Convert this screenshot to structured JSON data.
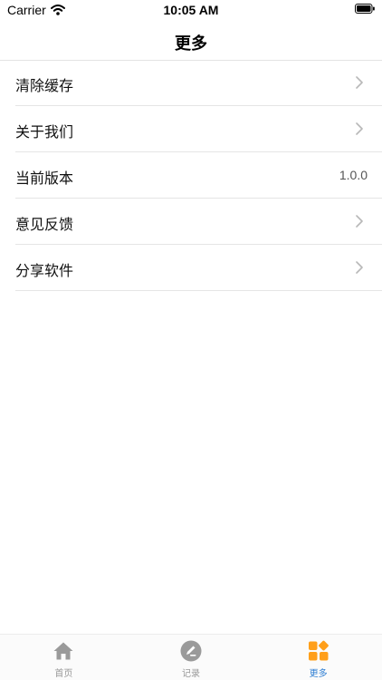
{
  "status_bar": {
    "carrier": "Carrier",
    "time": "10:05 AM"
  },
  "nav": {
    "title": "更多"
  },
  "menu": {
    "items": [
      {
        "label": "清除缓存",
        "value": ""
      },
      {
        "label": "关于我们",
        "value": ""
      },
      {
        "label": "当前版本",
        "value": "1.0.0"
      },
      {
        "label": "意见反馈",
        "value": ""
      },
      {
        "label": "分享软件",
        "value": ""
      }
    ]
  },
  "tabbar": {
    "tabs": [
      {
        "label": "首页",
        "icon": "home-icon"
      },
      {
        "label": "记录",
        "icon": "pencil-circle-icon"
      },
      {
        "label": "更多",
        "icon": "grid-icon",
        "active": true
      }
    ]
  },
  "colors": {
    "tab_active": "#2f7fd3",
    "tab_inactive": "#999999",
    "grid_icon": "#ff9f1a"
  }
}
